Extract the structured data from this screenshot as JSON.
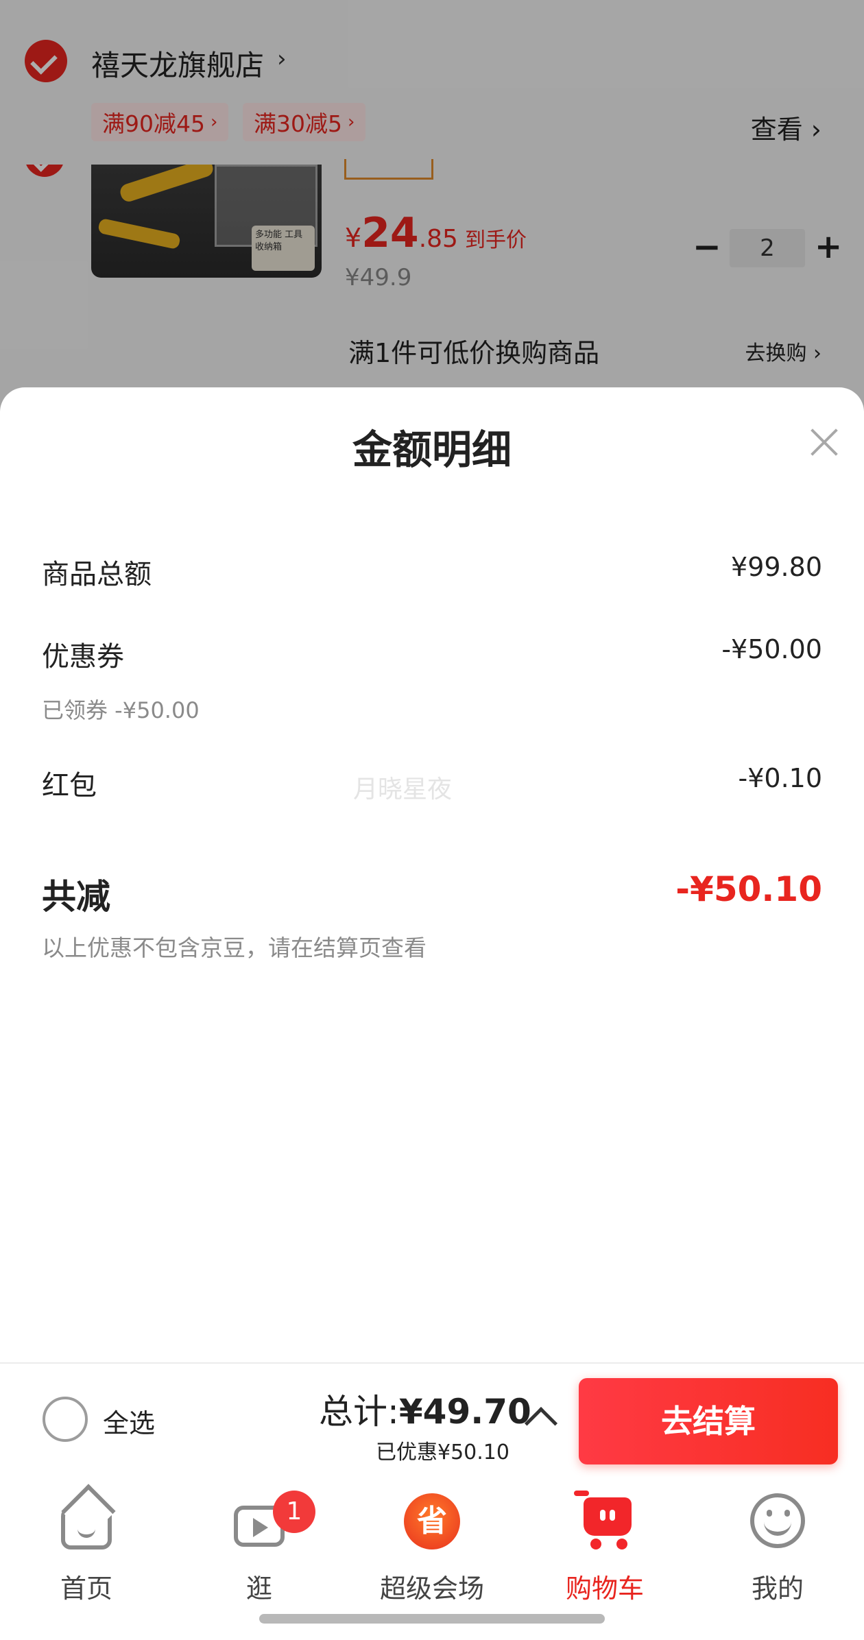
{
  "background_cart": {
    "store_name": "禧天龙旗舰店",
    "store_chevron": "›",
    "promos": [
      {
        "label": "满90减45",
        "chevron": "›"
      },
      {
        "label": "满30减5",
        "chevron": "›"
      }
    ],
    "view_label": "查看 ›",
    "product": {
      "image_tag": "多功能 工具收纳箱",
      "price_currency": "¥",
      "price_int": "24",
      "price_dec": ".85",
      "price_tail": "到手价",
      "original_price": "¥49.9",
      "quantity": "2",
      "minus": "−",
      "plus": "+"
    },
    "swap_text": "满1件可低价换购商品",
    "swap_link": "去换购 ›"
  },
  "sheet": {
    "title": "金额明细",
    "rows": {
      "goods_total": {
        "label": "商品总额",
        "value": "¥99.80"
      },
      "coupon": {
        "label": "优惠券",
        "value": "-¥50.00",
        "sub": "已领券 -¥50.00"
      },
      "red_packet": {
        "label": "红包",
        "value": "-¥0.10"
      }
    },
    "watermark": "月晓星夜",
    "total": {
      "label": "共减",
      "value": "-¥50.10"
    },
    "note": "以上优惠不包含京豆，请在结算页查看"
  },
  "footer": {
    "select_all": "全选",
    "total_prefix": "总计:",
    "total_amount": "¥49.70",
    "saved": "已优惠¥50.10",
    "checkout": "去结算"
  },
  "tabbar": {
    "tabs": [
      {
        "label": "首页",
        "icon": "home-icon"
      },
      {
        "label": "逛",
        "icon": "play-icon",
        "badge": "1"
      },
      {
        "label": "超级会场",
        "icon": "save-icon",
        "glyph": "省"
      },
      {
        "label": "购物车",
        "icon": "cart-icon",
        "active": true
      },
      {
        "label": "我的",
        "icon": "smile-icon"
      }
    ]
  },
  "colors": {
    "accent": "#e8251f",
    "checkout": "#f72e22"
  }
}
